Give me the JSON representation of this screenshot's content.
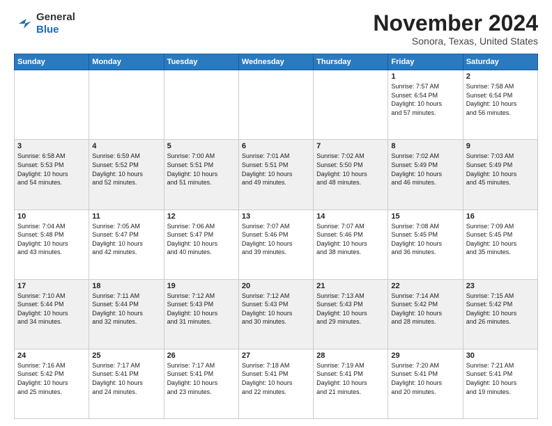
{
  "header": {
    "logo": {
      "general": "General",
      "blue": "Blue"
    },
    "title": "November 2024",
    "location": "Sonora, Texas, United States"
  },
  "calendar": {
    "days_of_week": [
      "Sunday",
      "Monday",
      "Tuesday",
      "Wednesday",
      "Thursday",
      "Friday",
      "Saturday"
    ],
    "weeks": [
      [
        {
          "day": "",
          "info": ""
        },
        {
          "day": "",
          "info": ""
        },
        {
          "day": "",
          "info": ""
        },
        {
          "day": "",
          "info": ""
        },
        {
          "day": "",
          "info": ""
        },
        {
          "day": "1",
          "info": "Sunrise: 7:57 AM\nSunset: 6:54 PM\nDaylight: 10 hours\nand 57 minutes."
        },
        {
          "day": "2",
          "info": "Sunrise: 7:58 AM\nSunset: 6:54 PM\nDaylight: 10 hours\nand 56 minutes."
        }
      ],
      [
        {
          "day": "3",
          "info": "Sunrise: 6:58 AM\nSunset: 5:53 PM\nDaylight: 10 hours\nand 54 minutes."
        },
        {
          "day": "4",
          "info": "Sunrise: 6:59 AM\nSunset: 5:52 PM\nDaylight: 10 hours\nand 52 minutes."
        },
        {
          "day": "5",
          "info": "Sunrise: 7:00 AM\nSunset: 5:51 PM\nDaylight: 10 hours\nand 51 minutes."
        },
        {
          "day": "6",
          "info": "Sunrise: 7:01 AM\nSunset: 5:51 PM\nDaylight: 10 hours\nand 49 minutes."
        },
        {
          "day": "7",
          "info": "Sunrise: 7:02 AM\nSunset: 5:50 PM\nDaylight: 10 hours\nand 48 minutes."
        },
        {
          "day": "8",
          "info": "Sunrise: 7:02 AM\nSunset: 5:49 PM\nDaylight: 10 hours\nand 46 minutes."
        },
        {
          "day": "9",
          "info": "Sunrise: 7:03 AM\nSunset: 5:49 PM\nDaylight: 10 hours\nand 45 minutes."
        }
      ],
      [
        {
          "day": "10",
          "info": "Sunrise: 7:04 AM\nSunset: 5:48 PM\nDaylight: 10 hours\nand 43 minutes."
        },
        {
          "day": "11",
          "info": "Sunrise: 7:05 AM\nSunset: 5:47 PM\nDaylight: 10 hours\nand 42 minutes."
        },
        {
          "day": "12",
          "info": "Sunrise: 7:06 AM\nSunset: 5:47 PM\nDaylight: 10 hours\nand 40 minutes."
        },
        {
          "day": "13",
          "info": "Sunrise: 7:07 AM\nSunset: 5:46 PM\nDaylight: 10 hours\nand 39 minutes."
        },
        {
          "day": "14",
          "info": "Sunrise: 7:07 AM\nSunset: 5:46 PM\nDaylight: 10 hours\nand 38 minutes."
        },
        {
          "day": "15",
          "info": "Sunrise: 7:08 AM\nSunset: 5:45 PM\nDaylight: 10 hours\nand 36 minutes."
        },
        {
          "day": "16",
          "info": "Sunrise: 7:09 AM\nSunset: 5:45 PM\nDaylight: 10 hours\nand 35 minutes."
        }
      ],
      [
        {
          "day": "17",
          "info": "Sunrise: 7:10 AM\nSunset: 5:44 PM\nDaylight: 10 hours\nand 34 minutes."
        },
        {
          "day": "18",
          "info": "Sunrise: 7:11 AM\nSunset: 5:44 PM\nDaylight: 10 hours\nand 32 minutes."
        },
        {
          "day": "19",
          "info": "Sunrise: 7:12 AM\nSunset: 5:43 PM\nDaylight: 10 hours\nand 31 minutes."
        },
        {
          "day": "20",
          "info": "Sunrise: 7:12 AM\nSunset: 5:43 PM\nDaylight: 10 hours\nand 30 minutes."
        },
        {
          "day": "21",
          "info": "Sunrise: 7:13 AM\nSunset: 5:43 PM\nDaylight: 10 hours\nand 29 minutes."
        },
        {
          "day": "22",
          "info": "Sunrise: 7:14 AM\nSunset: 5:42 PM\nDaylight: 10 hours\nand 28 minutes."
        },
        {
          "day": "23",
          "info": "Sunrise: 7:15 AM\nSunset: 5:42 PM\nDaylight: 10 hours\nand 26 minutes."
        }
      ],
      [
        {
          "day": "24",
          "info": "Sunrise: 7:16 AM\nSunset: 5:42 PM\nDaylight: 10 hours\nand 25 minutes."
        },
        {
          "day": "25",
          "info": "Sunrise: 7:17 AM\nSunset: 5:41 PM\nDaylight: 10 hours\nand 24 minutes."
        },
        {
          "day": "26",
          "info": "Sunrise: 7:17 AM\nSunset: 5:41 PM\nDaylight: 10 hours\nand 23 minutes."
        },
        {
          "day": "27",
          "info": "Sunrise: 7:18 AM\nSunset: 5:41 PM\nDaylight: 10 hours\nand 22 minutes."
        },
        {
          "day": "28",
          "info": "Sunrise: 7:19 AM\nSunset: 5:41 PM\nDaylight: 10 hours\nand 21 minutes."
        },
        {
          "day": "29",
          "info": "Sunrise: 7:20 AM\nSunset: 5:41 PM\nDaylight: 10 hours\nand 20 minutes."
        },
        {
          "day": "30",
          "info": "Sunrise: 7:21 AM\nSunset: 5:41 PM\nDaylight: 10 hours\nand 19 minutes."
        }
      ]
    ]
  }
}
